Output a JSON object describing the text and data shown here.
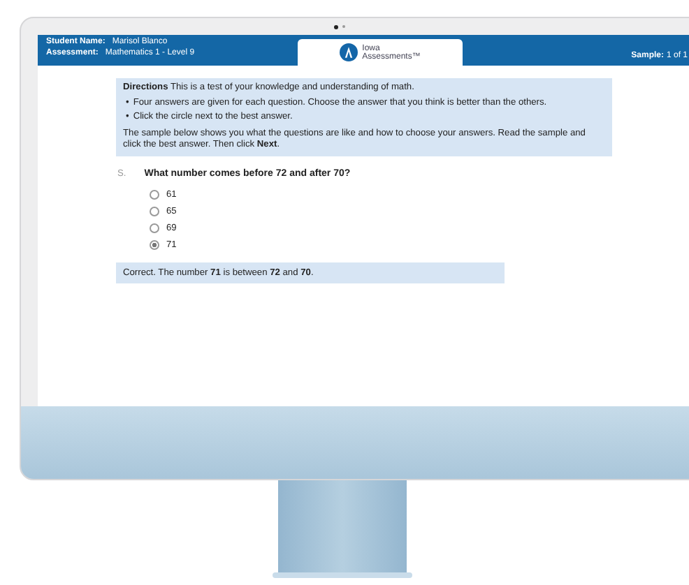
{
  "header": {
    "student_name_label": "Student Name:",
    "student_name": "Marisol Blanco",
    "assessment_label": "Assessment:",
    "assessment": "Mathematics 1 - Level 9",
    "logo_lines": [
      "Iowa",
      "Assessments™"
    ],
    "sample_label": "Sample:",
    "sample": "1 of 1"
  },
  "directions": {
    "intro": "**Directions** This is a test of your knowledge and understanding of math.",
    "bullet_marker": "•",
    "bullets": [
      "Four answers are given for each question. Choose the answer that you think is better than the others.",
      "Click the circle next to the best answer."
    ],
    "note": "The sample below shows you what the questions are like and how to choose your answers. Read the sample and click the best answer. Then click **Next**."
  },
  "question": {
    "number": "S.",
    "text": "What number comes before 72 and after 70?",
    "options": [
      {
        "label": "61",
        "selected": false
      },
      {
        "label": "65",
        "selected": false
      },
      {
        "label": "69",
        "selected": false
      },
      {
        "label": "71",
        "selected": true
      }
    ],
    "feedback": "Correct. The number **71** is between **72** and **70**."
  }
}
